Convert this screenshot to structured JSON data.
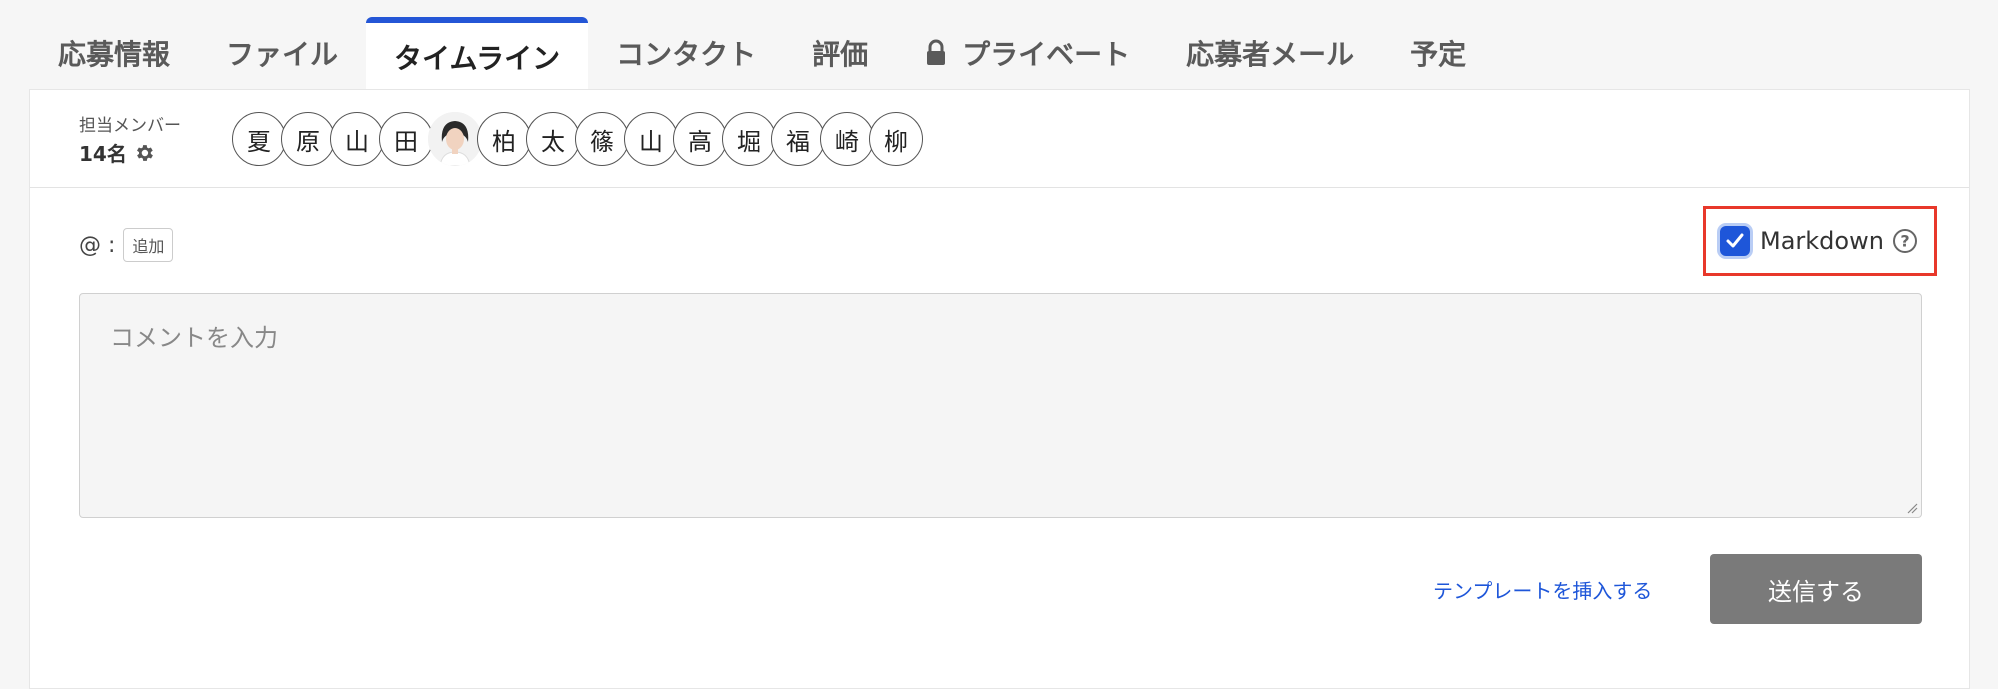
{
  "tabs": [
    {
      "label": "応募情報"
    },
    {
      "label": "ファイル"
    },
    {
      "label": "タイムライン",
      "active": true
    },
    {
      "label": "コンタクト"
    },
    {
      "label": "評価"
    },
    {
      "label": "プライベート",
      "icon": "lock-icon"
    },
    {
      "label": "応募者メール"
    },
    {
      "label": "予定"
    }
  ],
  "members": {
    "label": "担当メンバー",
    "count": "14名",
    "avatars": [
      "夏",
      "原",
      "山",
      "田",
      "",
      "柏",
      "太",
      "篠",
      "山",
      "高",
      "堀",
      "福",
      "崎",
      "柳"
    ]
  },
  "mention": {
    "prefix": "@ :",
    "add_label": "追加"
  },
  "markdown": {
    "label": "Markdown",
    "checked": true
  },
  "comment": {
    "placeholder": "コメントを入力"
  },
  "actions": {
    "template_label": "テンプレートを挿入する",
    "send_label": "送信する"
  },
  "colors": {
    "accent": "#2456d6",
    "highlight": "#e8382a",
    "send_disabled": "#7a7a7a"
  }
}
